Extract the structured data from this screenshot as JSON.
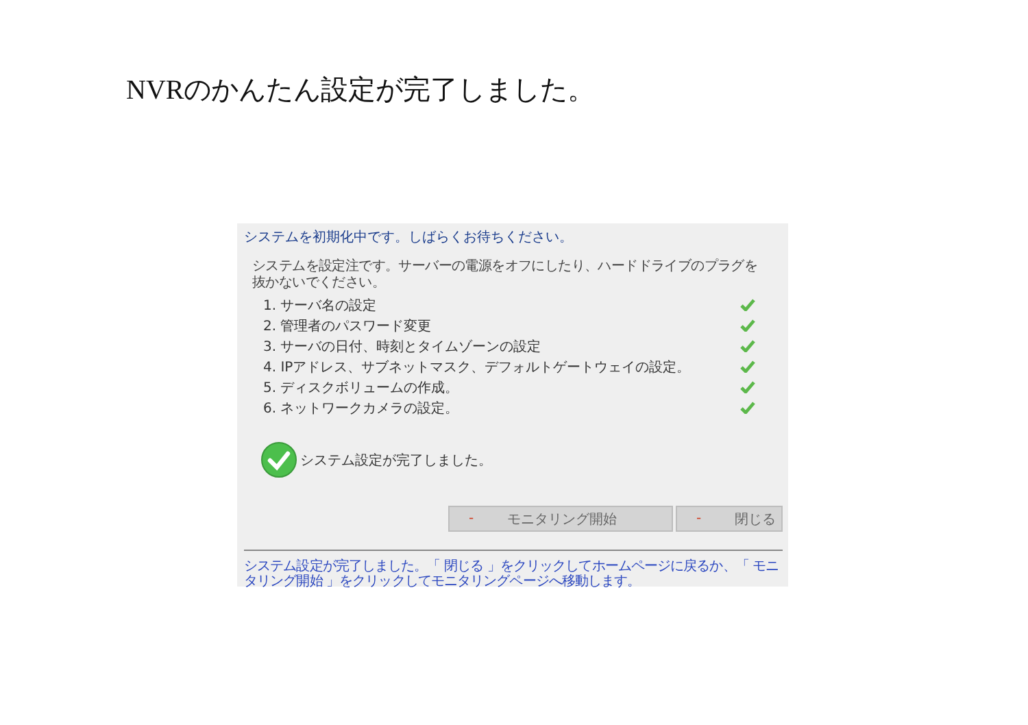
{
  "heading": "NVRのかんたん設定が完了しました。",
  "dialog": {
    "status": "システムを初期化中です。しばらくお待ちください。",
    "warning": "システムを設定注です。サーバーの電源をオフにしたり、ハードドライブのプラグを抜かないでください。",
    "steps": [
      {
        "label": "1. サーバ名の設定",
        "done": true
      },
      {
        "label": "2. 管理者のパスワード変更",
        "done": true
      },
      {
        "label": "3. サーバの日付、時刻とタイムゾーンの設定",
        "done": true
      },
      {
        "label": "4. IPアドレス、サブネットマスク、デフォルトゲートウェイの設定。",
        "done": true
      },
      {
        "label": "5. ディスクボリュームの作成。",
        "done": true
      },
      {
        "label": "6. ネットワークカメラの設定。",
        "done": true
      }
    ],
    "result": "システム設定が完了しました。",
    "buttons": [
      {
        "marker": "-",
        "label": "モニタリング開始"
      },
      {
        "marker": "-",
        "label": "閉じる"
      }
    ],
    "footer": "システム設定が完了しました。「 閉じる 」をクリックしてホームページに戻るか、「 モニタリング開始 」をクリックしてモニタリングページへ移動します。"
  }
}
